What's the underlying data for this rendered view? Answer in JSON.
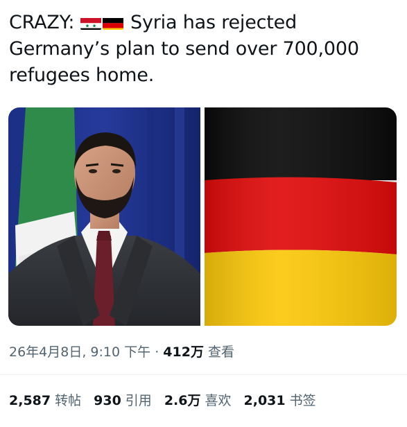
{
  "post": {
    "text_prefix": "CRAZY: ",
    "text_body": " Syria has rejected Germany’s plan to send over 700,000 refugees home."
  },
  "flags": {
    "syria": {
      "colors": [
        "#ce1126",
        "#ffffff",
        "#000000"
      ],
      "star_color": "#007a3d"
    },
    "germany": {
      "colors": [
        "#000000",
        "#dd0000",
        "#ffce00"
      ]
    }
  },
  "meta": {
    "datetime": "26年4月8日, 9:10 下午",
    "separator": "·",
    "views_count": "412万",
    "views_label": "查看"
  },
  "stats": [
    {
      "count": "2,587",
      "label": "转帖"
    },
    {
      "count": "930",
      "label": "引用"
    },
    {
      "count": "2.6万",
      "label": "喜欢"
    },
    {
      "count": "2,031",
      "label": "书签"
    }
  ]
}
